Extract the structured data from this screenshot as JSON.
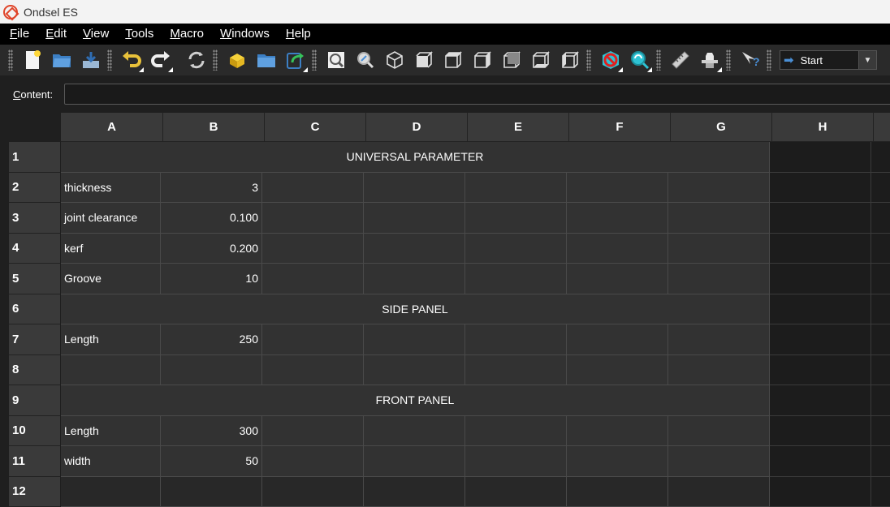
{
  "window": {
    "title": "Ondsel ES"
  },
  "menu": [
    {
      "label": "File",
      "mnemonic": "F"
    },
    {
      "label": "Edit",
      "mnemonic": "E"
    },
    {
      "label": "View",
      "mnemonic": "V"
    },
    {
      "label": "Tools",
      "mnemonic": "T"
    },
    {
      "label": "Macro",
      "mnemonic": "M"
    },
    {
      "label": "Windows",
      "mnemonic": "W"
    },
    {
      "label": "Help",
      "mnemonic": "H"
    }
  ],
  "toolbar": {
    "workbench": "Start",
    "icons": [
      "new-document-icon",
      "open-folder-icon",
      "save-icon",
      "undo-icon",
      "redo-icon",
      "refresh-icon",
      "part-icon",
      "folder-icon",
      "export-icon",
      "fit-all-icon",
      "fit-selection-icon",
      "isometric-view-icon",
      "front-view-icon",
      "top-view-icon",
      "right-view-icon",
      "rear-view-icon",
      "bottom-view-icon",
      "left-view-icon",
      "no-draw-style-icon",
      "sync-view-icon",
      "measure-icon",
      "workbench-icon",
      "whats-this-icon"
    ]
  },
  "content_bar": {
    "label": "Content:",
    "mnemonic": "C",
    "value": ""
  },
  "sheet": {
    "columns": [
      "A",
      "B",
      "C",
      "D",
      "E",
      "F",
      "G",
      "H"
    ],
    "rows": [
      "1",
      "2",
      "3",
      "4",
      "5",
      "6",
      "7",
      "8",
      "9",
      "10",
      "11",
      "12"
    ],
    "cells": {
      "r1_merged": "UNIVERSAL PARAMETER",
      "A2": "thickness",
      "B2": "3",
      "A3": "joint clearance",
      "B3": "0.100",
      "A4": "kerf",
      "B4": "0.200",
      "A5": "Groove",
      "B5": "10",
      "r6_merged": "SIDE PANEL",
      "A7": "Length",
      "B7": "250",
      "r9_merged": "FRONT PANEL",
      "A10": "Length",
      "B10": "300",
      "A11": "width",
      "B11": "50"
    }
  },
  "colors": {
    "accent_red": "#e0452a",
    "cell_bg": "#323232",
    "header_bg": "#3a3a3a"
  }
}
